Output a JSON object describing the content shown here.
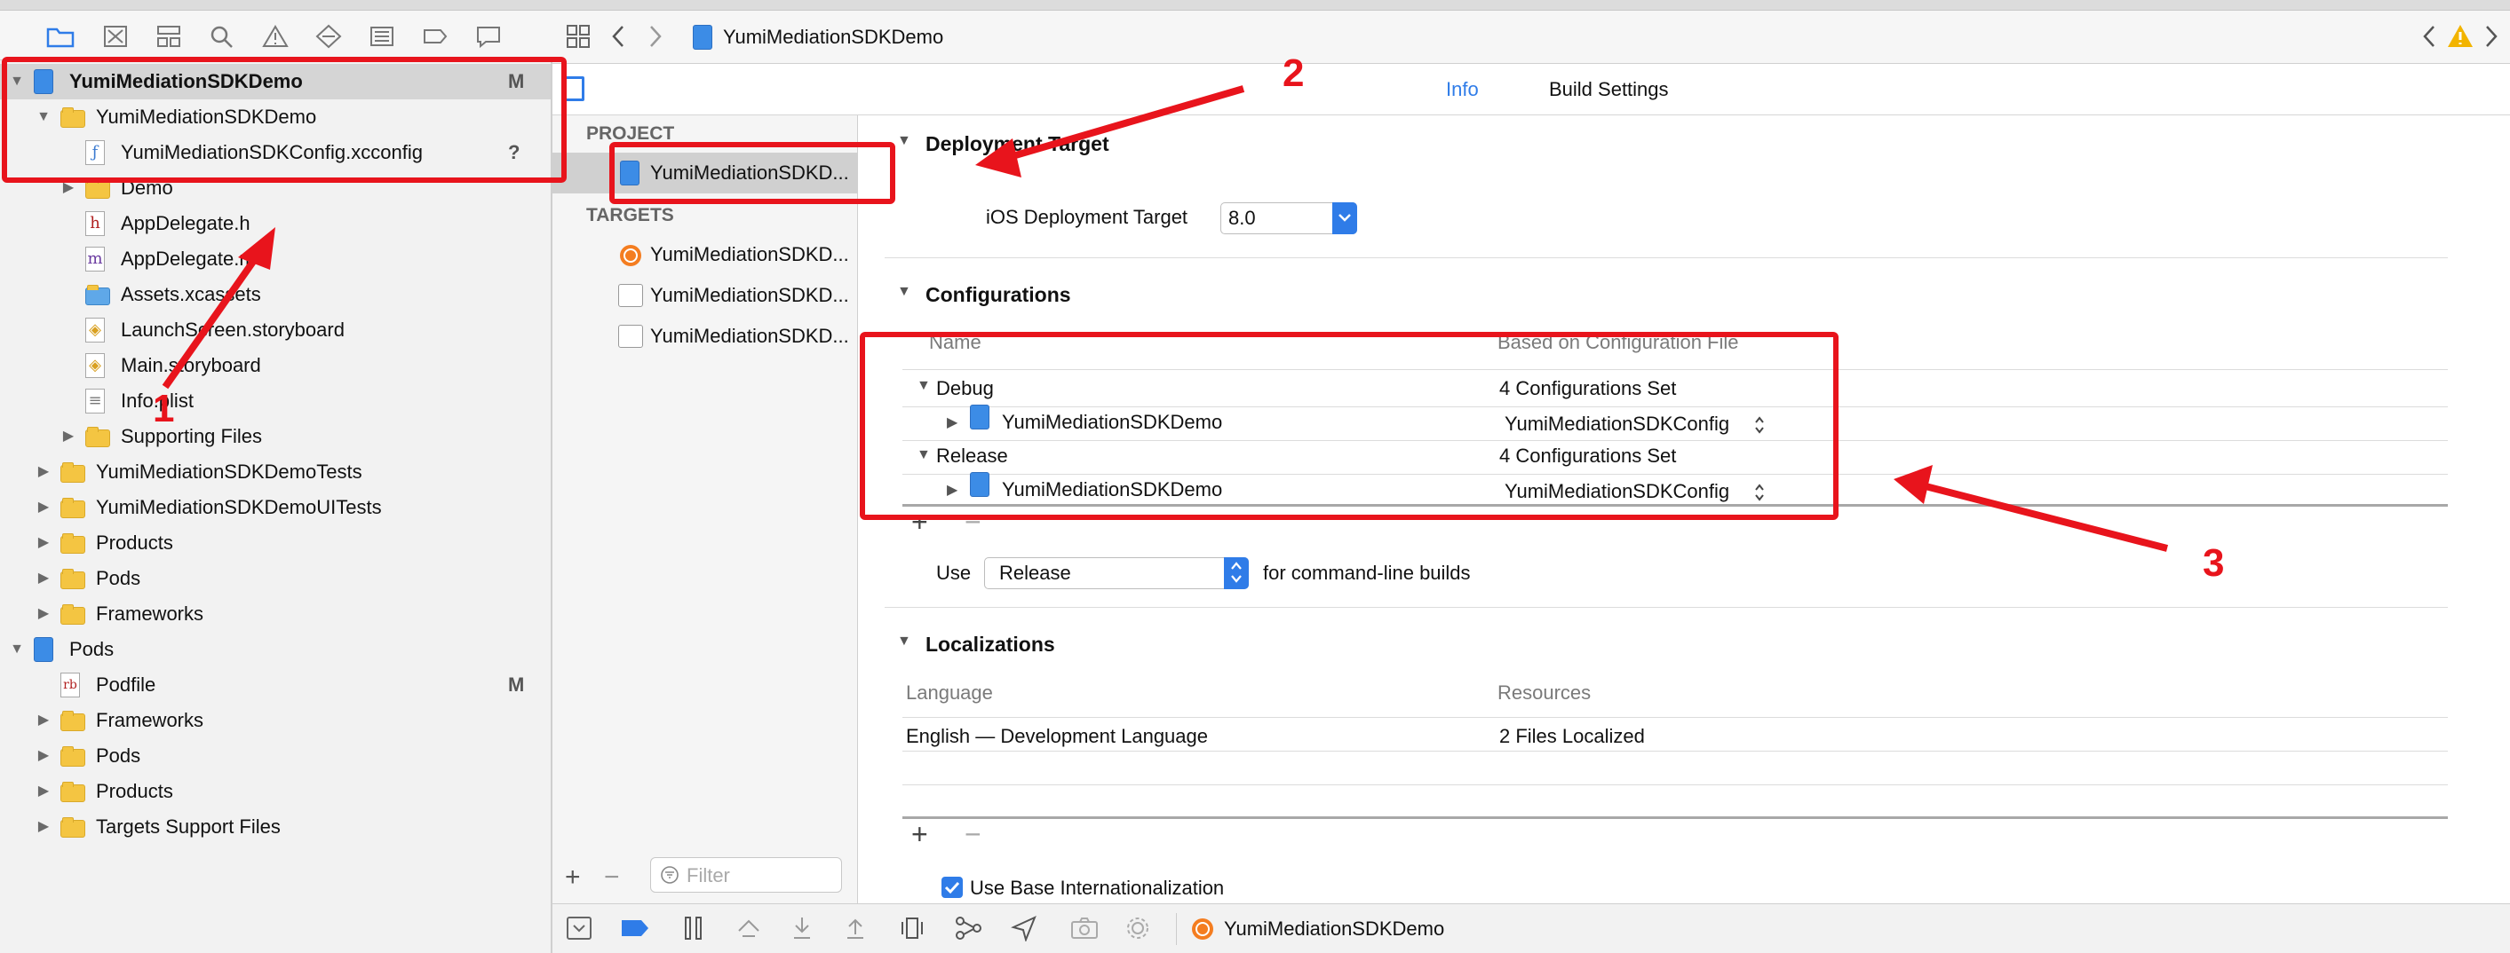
{
  "navigator": {
    "toolbar_icons": [
      "folder-icon",
      "source-control-icon",
      "symbol-icon",
      "search-icon",
      "issue-warning-icon",
      "test-icon",
      "debug-icon",
      "breakpoint-icon",
      "report-icon"
    ],
    "rows": [
      {
        "label": "YumiMediationSDKDemo",
        "badge": "M",
        "icon": "project-icon",
        "level": 0,
        "disclosure": "open",
        "selected": true,
        "bold": true
      },
      {
        "label": "YumiMediationSDKDemo",
        "badge": "",
        "icon": "folder-icon",
        "level": 1,
        "disclosure": "open"
      },
      {
        "label": "YumiMediationSDKConfig.xcconfig",
        "badge": "?",
        "icon": "xcconfig-file-icon",
        "level": 2,
        "disclosure": "none"
      },
      {
        "label": "Demo",
        "badge": "",
        "icon": "folder-icon",
        "level": 2,
        "disclosure": "closed"
      },
      {
        "label": "AppDelegate.h",
        "badge": "",
        "icon": "header-file-icon",
        "level": 2,
        "disclosure": "none"
      },
      {
        "label": "AppDelegate.m",
        "badge": "",
        "icon": "source-file-icon",
        "level": 2,
        "disclosure": "none"
      },
      {
        "label": "Assets.xcassets",
        "badge": "",
        "icon": "asset-catalog-icon",
        "level": 2,
        "disclosure": "none"
      },
      {
        "label": "LaunchScreen.storyboard",
        "badge": "",
        "icon": "storyboard-icon",
        "level": 2,
        "disclosure": "none"
      },
      {
        "label": "Main.storyboard",
        "badge": "",
        "icon": "storyboard-icon",
        "level": 2,
        "disclosure": "none"
      },
      {
        "label": "Info.plist",
        "badge": "",
        "icon": "plist-file-icon",
        "level": 2,
        "disclosure": "none"
      },
      {
        "label": "Supporting Files",
        "badge": "",
        "icon": "folder-icon",
        "level": 2,
        "disclosure": "closed"
      },
      {
        "label": "YumiMediationSDKDemoTests",
        "badge": "",
        "icon": "folder-icon",
        "level": 1,
        "disclosure": "closed"
      },
      {
        "label": "YumiMediationSDKDemoUITests",
        "badge": "",
        "icon": "folder-icon",
        "level": 1,
        "disclosure": "closed"
      },
      {
        "label": "Products",
        "badge": "",
        "icon": "folder-icon",
        "level": 1,
        "disclosure": "closed"
      },
      {
        "label": "Pods",
        "badge": "",
        "icon": "folder-icon",
        "level": 1,
        "disclosure": "closed"
      },
      {
        "label": "Frameworks",
        "badge": "",
        "icon": "folder-icon",
        "level": 1,
        "disclosure": "closed"
      },
      {
        "label": "Pods",
        "badge": "",
        "icon": "project-icon",
        "level": 0,
        "disclosure": "open"
      },
      {
        "label": "Podfile",
        "badge": "M",
        "icon": "ruby-file-icon",
        "level": 1,
        "disclosure": "none"
      },
      {
        "label": "Frameworks",
        "badge": "",
        "icon": "folder-icon",
        "level": 1,
        "disclosure": "closed"
      },
      {
        "label": "Pods",
        "badge": "",
        "icon": "folder-icon",
        "level": 1,
        "disclosure": "closed"
      },
      {
        "label": "Products",
        "badge": "",
        "icon": "folder-icon",
        "level": 1,
        "disclosure": "closed"
      },
      {
        "label": "Targets Support Files",
        "badge": "",
        "icon": "folder-icon",
        "level": 1,
        "disclosure": "closed"
      }
    ]
  },
  "breadcrumb": {
    "project": "YumiMediationSDKDemo"
  },
  "tabs": {
    "info": "Info",
    "build_settings": "Build Settings"
  },
  "project_list": {
    "project_header": "PROJECT",
    "project_item": "YumiMediationSDKD...",
    "targets_header": "TARGETS",
    "targets": [
      "YumiMediationSDKD...",
      "YumiMediationSDKD...",
      "YumiMediationSDKD..."
    ],
    "filter_placeholder": "Filter"
  },
  "deployment": {
    "section": "Deployment Target",
    "label": "iOS Deployment Target",
    "value": "8.0"
  },
  "configurations": {
    "section": "Configurations",
    "col_name": "Name",
    "col_based_on": "Based on Configuration File",
    "groups": [
      {
        "name": "Debug",
        "summary": "4 Configurations Set",
        "child": "YumiMediationSDKDemo",
        "config_file": "YumiMediationSDKConfig"
      },
      {
        "name": "Release",
        "summary": "4 Configurations Set",
        "child": "YumiMediationSDKDemo",
        "config_file": "YumiMediationSDKConfig"
      }
    ],
    "use_label": "Use",
    "use_value": "Release",
    "use_suffix": "for command-line builds"
  },
  "localizations": {
    "section": "Localizations",
    "col_language": "Language",
    "col_resources": "Resources",
    "rows": [
      {
        "language": "English — Development Language",
        "resources": "2 Files Localized"
      }
    ],
    "base_internationalization": "Use Base Internationalization"
  },
  "bottom": {
    "scheme": "YumiMediationSDKDemo"
  },
  "annotations": {
    "n1": "1",
    "n2": "2",
    "n3": "3"
  },
  "colors": {
    "accent": "#2f7ce8",
    "annotation": "#e8141c",
    "folder": "#f4c542",
    "warning": "#f2b400"
  }
}
